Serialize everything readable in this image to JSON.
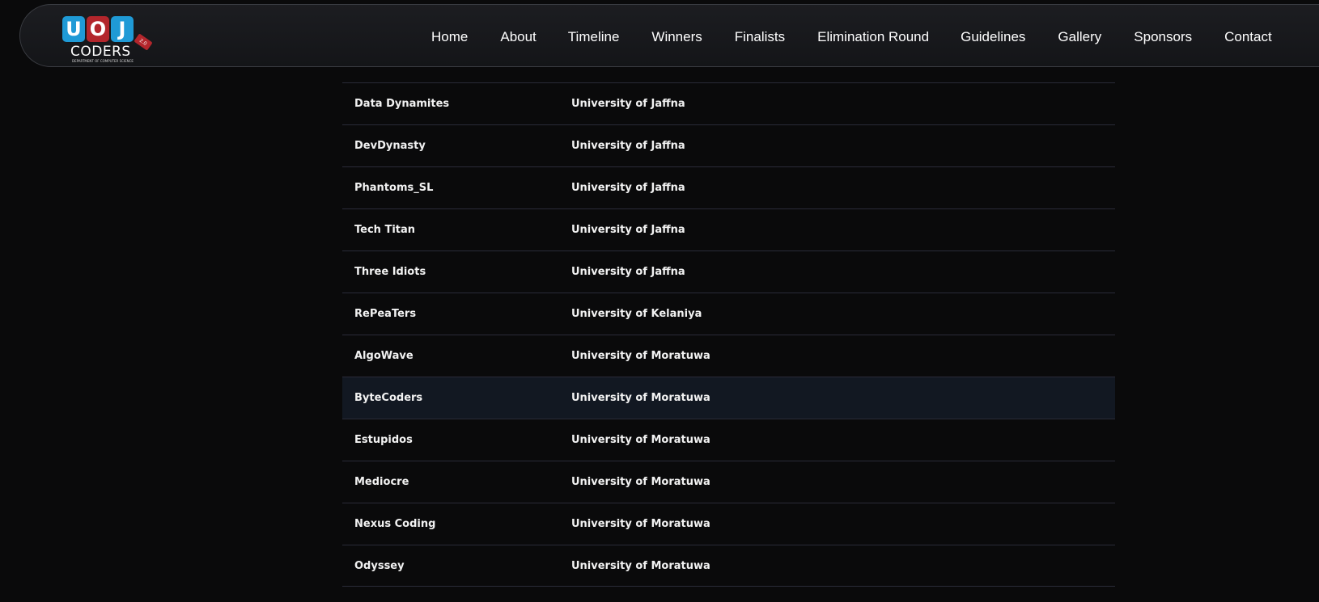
{
  "logo": {
    "letters": [
      "U",
      "O",
      "J"
    ],
    "word": "CODERS",
    "subtitle": "DEPARTMENT OF COMPUTER SCIENCE",
    "tag": "2.0",
    "colors": {
      "blue": "#1f9ad6",
      "red": "#b3262c"
    }
  },
  "nav": {
    "items": [
      {
        "label": "Home"
      },
      {
        "label": "About"
      },
      {
        "label": "Timeline"
      },
      {
        "label": "Winners"
      },
      {
        "label": "Finalists"
      },
      {
        "label": "Elimination Round"
      },
      {
        "label": "Guidelines"
      },
      {
        "label": "Gallery"
      },
      {
        "label": "Sponsors"
      },
      {
        "label": "Contact"
      }
    ]
  },
  "teams": {
    "rows": [
      {
        "team": "Data Dynamites",
        "university": "University of Jaffna"
      },
      {
        "team": "DevDynasty",
        "university": "University of Jaffna"
      },
      {
        "team": "Phantoms_SL",
        "university": "University of Jaffna"
      },
      {
        "team": "Tech Titan",
        "university": "University of Jaffna"
      },
      {
        "team": "Three Idiots",
        "university": "University of Jaffna"
      },
      {
        "team": "RePeaTers",
        "university": "University of Kelaniya"
      },
      {
        "team": "AlgoWave",
        "university": "University of Moratuwa"
      },
      {
        "team": "ByteCoders",
        "university": "University of Moratuwa"
      },
      {
        "team": "Estupidos",
        "university": "University of Moratuwa"
      },
      {
        "team": "Mediocre",
        "university": "University of Moratuwa"
      },
      {
        "team": "Nexus Coding",
        "university": "University of Moratuwa"
      },
      {
        "team": "Odyssey",
        "university": "University of Moratuwa"
      }
    ]
  }
}
